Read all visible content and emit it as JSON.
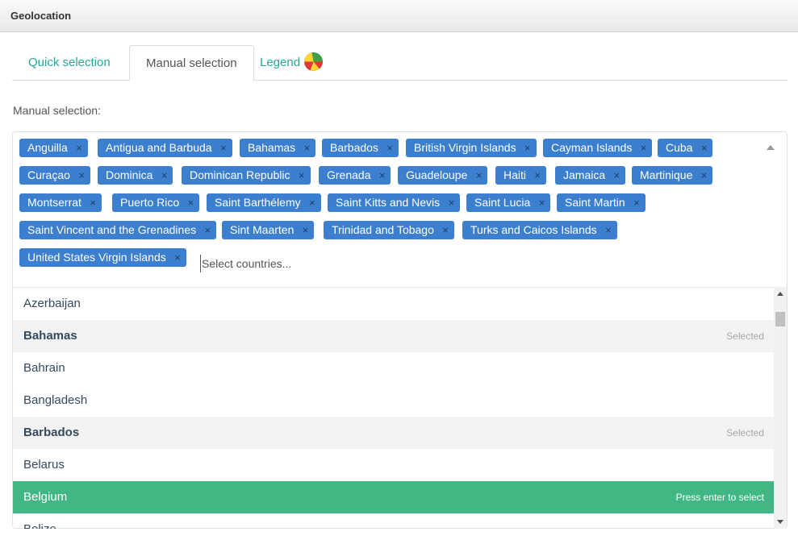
{
  "panel": {
    "title": "Geolocation"
  },
  "tabs": [
    {
      "label": "Quick selection"
    },
    {
      "label": "Manual selection"
    },
    {
      "label": "Legend"
    }
  ],
  "field": {
    "label": "Manual selection:",
    "placeholder": "Select countries..."
  },
  "tags": [
    {
      "label": "Anguilla"
    },
    {
      "label": "Antigua and Barbuda"
    },
    {
      "label": "Bahamas"
    },
    {
      "label": "Barbados"
    },
    {
      "label": "British Virgin Islands"
    },
    {
      "label": "Cayman Islands"
    },
    {
      "label": "Cuba"
    },
    {
      "label": "Curaçao"
    },
    {
      "label": "Dominica"
    },
    {
      "label": "Dominican Republic"
    },
    {
      "label": "Grenada"
    },
    {
      "label": "Guadeloupe"
    },
    {
      "label": "Haiti"
    },
    {
      "label": "Jamaica"
    },
    {
      "label": "Martinique"
    },
    {
      "label": "Montserrat"
    },
    {
      "label": "Puerto Rico"
    },
    {
      "label": "Saint Barthélemy"
    },
    {
      "label": "Saint Kitts and Nevis"
    },
    {
      "label": "Saint Lucia"
    },
    {
      "label": "Saint Martin"
    },
    {
      "label": "Saint Vincent and the Grenadines"
    },
    {
      "label": "Sint Maarten"
    },
    {
      "label": "Trinidad and Tobago"
    },
    {
      "label": "Turks and Caicos Islands"
    },
    {
      "label": "United States Virgin Islands"
    }
  ],
  "tag_remove_glyph": "×",
  "options": [
    {
      "label": "Azerbaijan",
      "state": "normal",
      "hint": ""
    },
    {
      "label": "Bahamas",
      "state": "selected",
      "hint": "Selected"
    },
    {
      "label": "Bahrain",
      "state": "normal",
      "hint": ""
    },
    {
      "label": "Bangladesh",
      "state": "normal",
      "hint": ""
    },
    {
      "label": "Barbados",
      "state": "selected",
      "hint": "Selected"
    },
    {
      "label": "Belarus",
      "state": "normal",
      "hint": ""
    },
    {
      "label": "Belgium",
      "state": "highlight",
      "hint": "Press enter to select"
    },
    {
      "label": "Belize",
      "state": "normal",
      "hint": ""
    }
  ],
  "colors": {
    "tab_accent": "#26a69a",
    "tag_bg": "#3b7fce",
    "highlight_bg": "#41b883",
    "selected_bg": "#f3f3f3"
  },
  "icons": {
    "legend": "legend-color-circle-icon",
    "dropdown": "caret-up-icon"
  }
}
